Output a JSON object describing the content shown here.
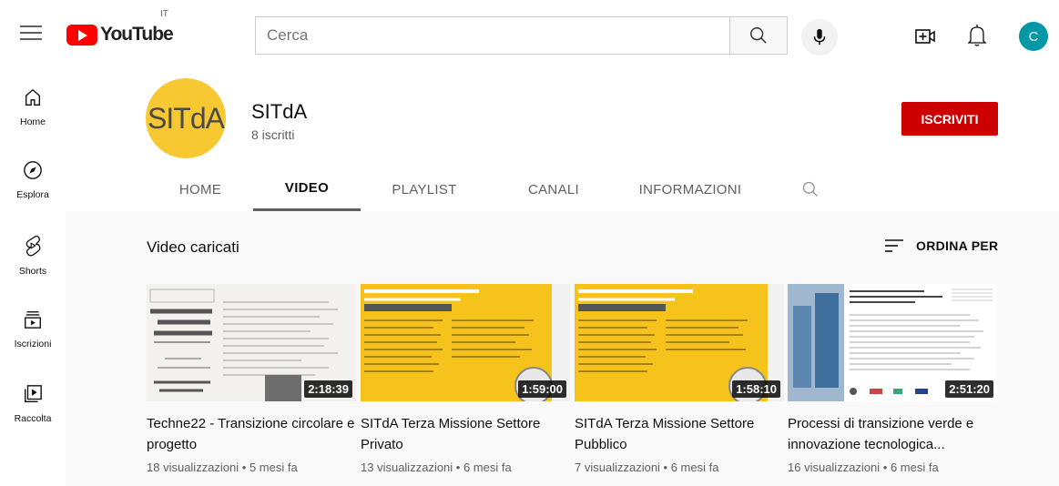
{
  "header": {
    "logo_text": "YouTube",
    "country_code": "IT",
    "search_placeholder": "Cerca",
    "avatar_letter": "C"
  },
  "sidebar": {
    "items": [
      {
        "label": "Home",
        "icon": "home-icon"
      },
      {
        "label": "Esplora",
        "icon": "compass-icon"
      },
      {
        "label": "Shorts",
        "icon": "shorts-icon"
      },
      {
        "label": "Iscrizioni",
        "icon": "subscriptions-icon"
      },
      {
        "label": "Raccolta",
        "icon": "library-icon"
      }
    ]
  },
  "channel": {
    "name": "SITdA",
    "subscribers": "8 iscritti",
    "avatar_text": "SITdA",
    "subscribe_label": "ISCRIVITI"
  },
  "tabs": [
    "HOME",
    "VIDEO",
    "PLAYLIST",
    "CANALI",
    "INFORMAZIONI"
  ],
  "content": {
    "section_title": "Video caricati",
    "sort_label": "ORDINA PER"
  },
  "videos": [
    {
      "title": "Techne22 - Transizione circolare e progetto",
      "views": "18 visualizzazioni",
      "age": "5 mesi fa",
      "duration": "2:18:39"
    },
    {
      "title": "SITdA Terza Missione Settore Privato",
      "views": "13 visualizzazioni",
      "age": "6 mesi fa",
      "duration": "1:59:00"
    },
    {
      "title": "SITdA Terza Missione Settore Pubblico",
      "views": "7 visualizzazioni",
      "age": "6 mesi fa",
      "duration": "1:58:10"
    },
    {
      "title": "Processi di transizione verde e innovazione tecnologica...",
      "views": "16 visualizzazioni",
      "age": "6 mesi fa",
      "duration": "2:51:20"
    }
  ],
  "colors": {
    "brand_red": "#ff0000",
    "subscribe_red": "#cc0000",
    "channel_yellow": "#f7c832",
    "avatar_teal": "#0097a7"
  }
}
